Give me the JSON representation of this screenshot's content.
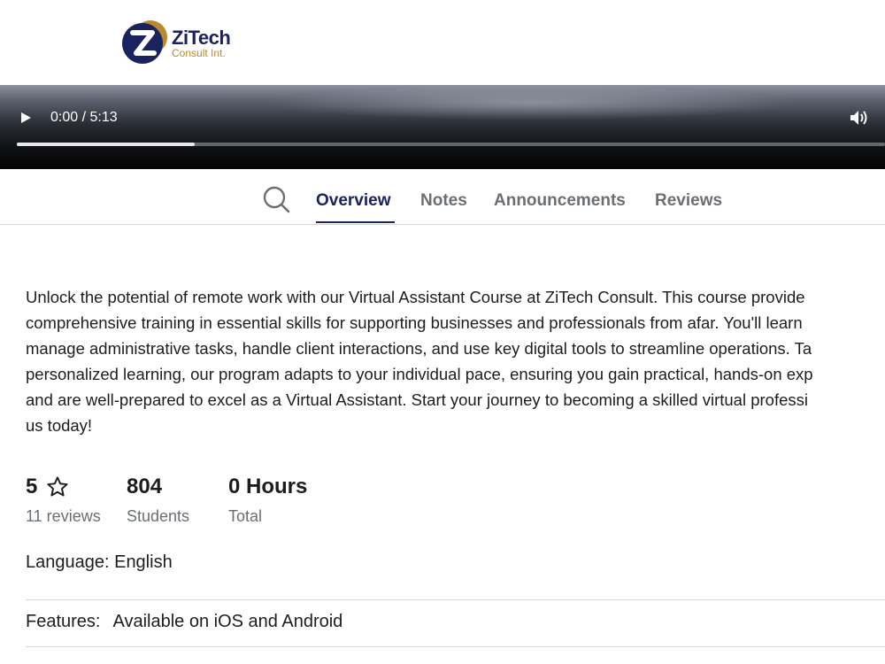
{
  "brand": {
    "name": "ZiTech",
    "tagline": "Consult Int.",
    "colors": {
      "primary": "#1a2260",
      "accent": "#b9892e"
    }
  },
  "player": {
    "time_display": "0:00 / 5:13",
    "buffered_fraction": 0.205,
    "icons": {
      "play": "play-icon",
      "volume": "volume-icon"
    }
  },
  "tabs": {
    "search_icon": "search-icon",
    "items": [
      {
        "label": "Overview",
        "active": true
      },
      {
        "label": "Notes",
        "active": false
      },
      {
        "label": "Announcements",
        "active": false
      },
      {
        "label": "Reviews",
        "active": false
      }
    ]
  },
  "overview": {
    "description_lines": [
      "Unlock the potential of remote work with our Virtual Assistant Course at ZiTech Consult. This course provide",
      "comprehensive training in essential skills for supporting businesses and professionals from afar. You'll learn",
      "manage administrative tasks, handle client interactions, and use key digital tools to streamline operations. Ta",
      "personalized learning, our program adapts to your individual pace, ensuring you gain practical, hands-on exp",
      "and are well-prepared to excel as a Virtual Assistant. Start your journey to becoming a skilled virtual professi",
      "us today!"
    ],
    "stats": {
      "rating": {
        "value": "5",
        "label": "11 reviews",
        "icon": "star-outline-icon"
      },
      "students": {
        "value": "804",
        "label": "Students"
      },
      "hours": {
        "value": "0 Hours",
        "label": "Total"
      }
    },
    "language": "Language: English",
    "features": {
      "label": "Features:",
      "value": "Available on iOS and Android"
    }
  }
}
